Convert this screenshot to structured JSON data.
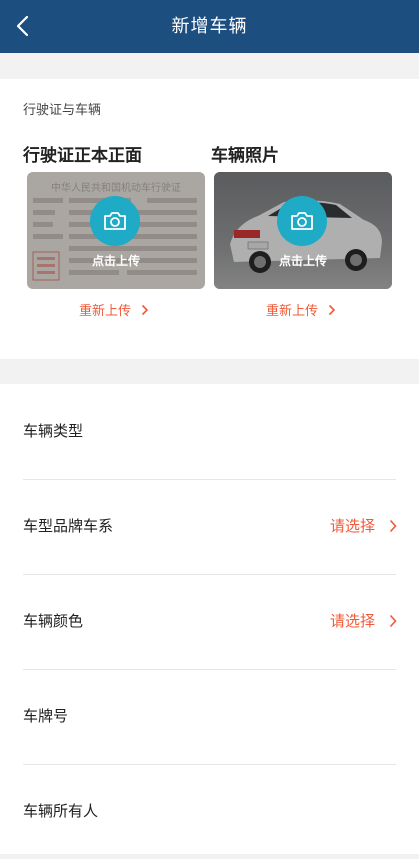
{
  "header": {
    "title": "新增车辆"
  },
  "upload": {
    "section_label": "行驶证与车辆",
    "license": {
      "title": "行驶证正本正面",
      "tap_label": "点击上传",
      "reupload_label": "重新上传",
      "doc_heading": "中华人民共和国机动车行驶证"
    },
    "vehicle": {
      "title": "车辆照片",
      "tap_label": "点击上传",
      "reupload_label": "重新上传"
    }
  },
  "form": {
    "rows": [
      {
        "label": "车辆类型",
        "value": ""
      },
      {
        "label": "车型品牌车系",
        "value": "请选择"
      },
      {
        "label": "车辆颜色",
        "value": "请选择"
      },
      {
        "label": "车牌号",
        "value": ""
      },
      {
        "label": "车辆所有人",
        "value": ""
      }
    ]
  },
  "colors": {
    "header": "#1d4e80",
    "accent": "#f05a3a",
    "camera": "#1faac6"
  }
}
